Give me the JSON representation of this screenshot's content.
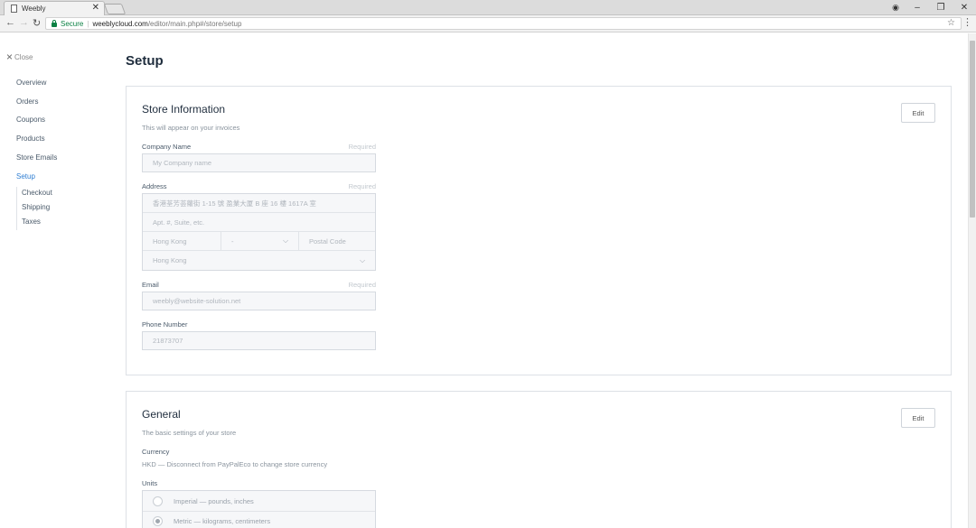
{
  "browser": {
    "tab_title": "Weebly",
    "tab_close": "✕",
    "secure_label": "Secure",
    "url_host": "weeblycloud.com",
    "url_path": "/editor/main.php#/store/setup",
    "window_controls": {
      "minimize": "–",
      "restore": "❐",
      "close": "✕"
    }
  },
  "sidebar": {
    "close_label": "Close",
    "items": [
      {
        "label": "Overview"
      },
      {
        "label": "Orders"
      },
      {
        "label": "Coupons"
      },
      {
        "label": "Products"
      },
      {
        "label": "Store Emails"
      },
      {
        "label": "Setup",
        "active": true
      }
    ],
    "sub_items": [
      {
        "label": "Checkout"
      },
      {
        "label": "Shipping"
      },
      {
        "label": "Taxes"
      }
    ]
  },
  "page": {
    "title": "Setup"
  },
  "store_info": {
    "title": "Store Information",
    "subtitle": "This will appear on your invoices",
    "edit_label": "Edit",
    "required_label": "Required",
    "company_label": "Company Name",
    "company_placeholder": "My Company name",
    "address_label": "Address",
    "address_line1": "香港荃芳荟蘿街 1-15 號 盈業大厦 B 座 16 樓 1617A 室",
    "address_line2_placeholder": "Apt. #, Suite, etc.",
    "city": "Hong Kong",
    "region": "-",
    "postal_placeholder": "Postal Code",
    "country": "Hong Kong",
    "email_label": "Email",
    "email_value": "weebly@website-solution.net",
    "phone_label": "Phone Number",
    "phone_value": "21873707"
  },
  "general": {
    "title": "General",
    "subtitle": "The basic settings of your store",
    "edit_label": "Edit",
    "currency_label": "Currency",
    "currency_value": "HKD — Disconnect from PayPalEco to change store currency",
    "units_label": "Units",
    "units_options": [
      {
        "label": "Imperial — pounds, inches",
        "checked": false
      },
      {
        "label": "Metric — kilograms, centimeters",
        "checked": true
      }
    ]
  },
  "colors": {
    "accent": "#2d7dd2",
    "secure": "#0b8043"
  }
}
